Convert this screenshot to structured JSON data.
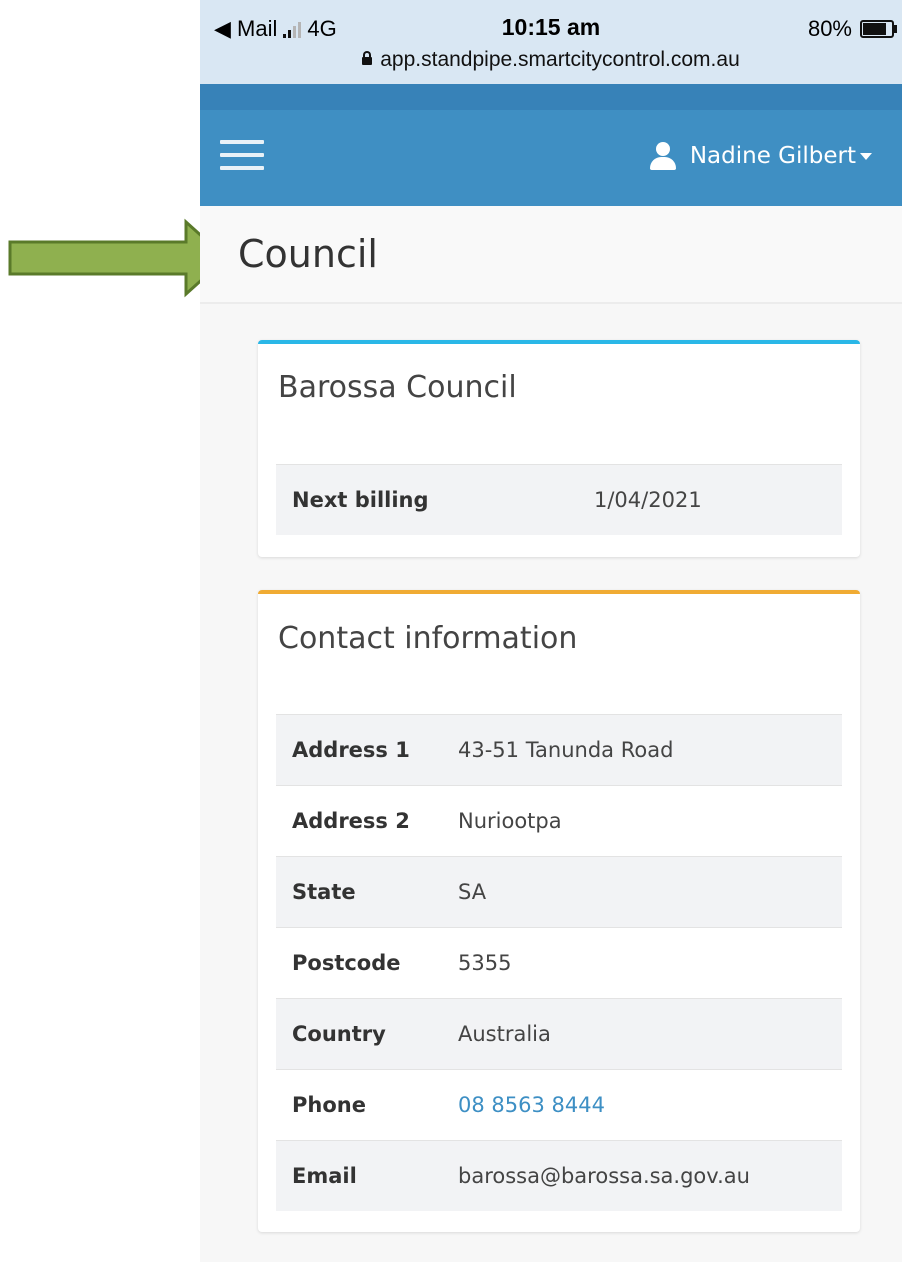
{
  "status_bar": {
    "back_app": "◀ Mail",
    "network": "4G",
    "time": "10:15 am",
    "battery": "80%",
    "url": "app.standpipe.smartcitycontrol.com.au"
  },
  "navbar": {
    "user_name": "Nadine Gilbert"
  },
  "page": {
    "title": "Council"
  },
  "council_card": {
    "title": "Barossa Council",
    "rows": [
      {
        "label": "Next billing",
        "value": "1/04/2021"
      }
    ]
  },
  "contact_card": {
    "title": "Contact information",
    "rows": [
      {
        "label": "Address 1",
        "value": "43-51 Tanunda Road"
      },
      {
        "label": "Address 2",
        "value": "Nuriootpa"
      },
      {
        "label": "State",
        "value": "SA"
      },
      {
        "label": "Postcode",
        "value": "5355"
      },
      {
        "label": "Country",
        "value": "Australia"
      },
      {
        "label": "Phone",
        "value": "08 8563 8444"
      },
      {
        "label": "Email",
        "value": "barossa@barossa.sa.gov.au"
      }
    ]
  },
  "colors": {
    "navbar": "#3f8fc3",
    "council_card_accent": "#2ab7e7",
    "contact_card_accent": "#f0ab33",
    "link": "#3d8fc4",
    "annotation_arrow": "#8fb04f"
  },
  "icons": [
    "green-arrow-annotation",
    "hamburger-menu-icon",
    "user-icon",
    "caret-down-icon",
    "lock-icon",
    "battery-icon",
    "signal-icon"
  ]
}
